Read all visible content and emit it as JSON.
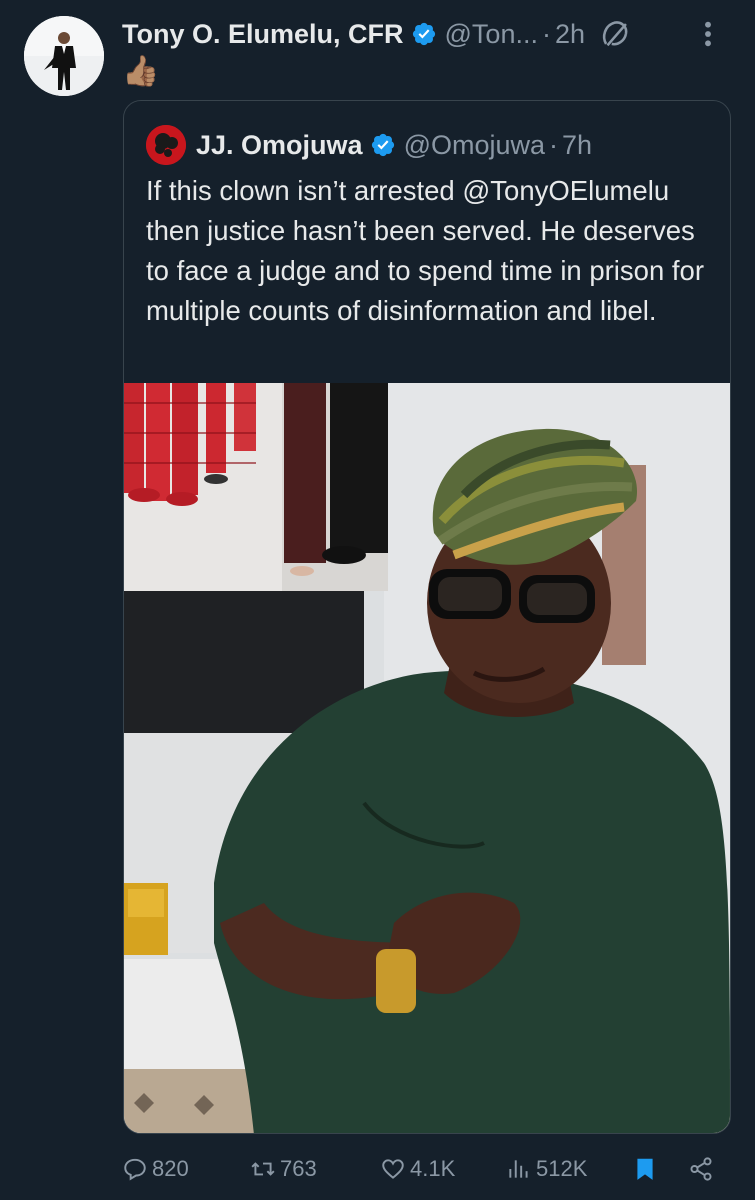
{
  "post": {
    "author_name": "Tony O. Elumelu, CFR",
    "author_handle": "@Ton...",
    "separator": "·",
    "time": "2h",
    "text": "👍🏽"
  },
  "quote": {
    "author_name": "JJ. Omojuwa",
    "author_handle": "@Omojuwa",
    "separator": "·",
    "time": "7h",
    "text": "If this clown isn’t arrested @TonyOElumelu then justice hasn’t been served. He deserves to face a judge and to spend time in prison for multiple counts of disinformation and libel."
  },
  "actions": {
    "replies": "820",
    "reposts": "763",
    "likes": "4.1K",
    "views": "512K"
  },
  "colors": {
    "background": "#15202b",
    "text": "#e7e9ea",
    "muted": "#8b98a5",
    "verified": "#1d9bf0",
    "border": "#38444d"
  },
  "icons": [
    "verified-badge-icon",
    "grok-icon",
    "more-icon",
    "reply-icon",
    "repost-icon",
    "like-icon",
    "views-icon",
    "bookmark-icon",
    "share-icon"
  ]
}
